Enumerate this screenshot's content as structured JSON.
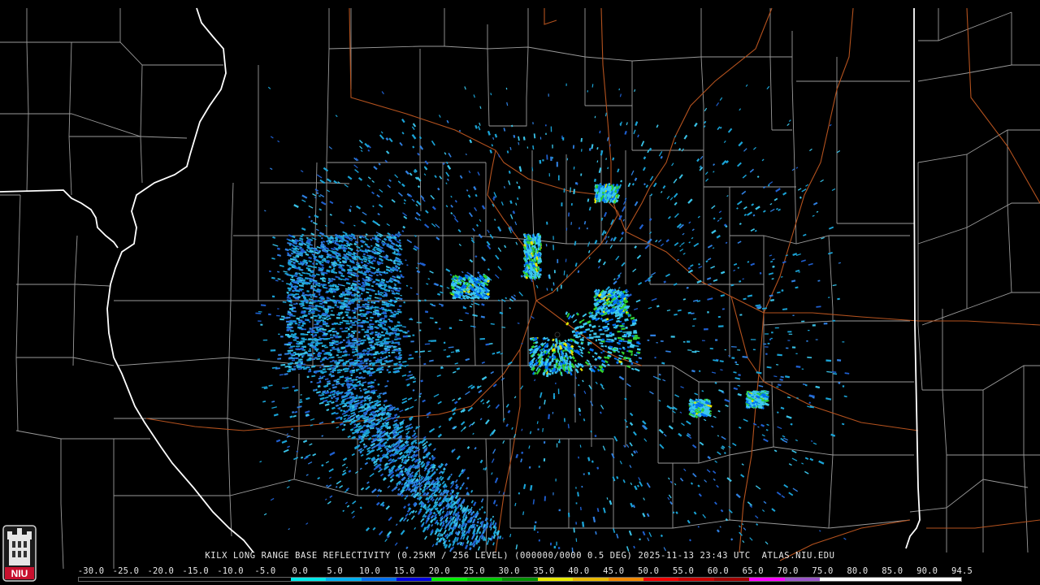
{
  "product_caption": "KILX LONG RANGE BASE REFLECTIVITY (0.25KM / 256 LEVEL) (000000/0000 0.5 DEG) 2025-11-13 23:43 UTC  ATLAS.NIU.EDU",
  "logo_text": "NIU",
  "colorbar": {
    "labels": [
      "-30.0",
      "-25.0",
      "-20.0",
      "-15.0",
      "-10.0",
      "-5.0",
      "0.0",
      "5.0",
      "10.0",
      "15.0",
      "20.0",
      "25.0",
      "30.0",
      "35.0",
      "40.0",
      "45.0",
      "50.0",
      "55.0",
      "60.0",
      "65.0",
      "70.0",
      "75.0",
      "80.0",
      "85.0",
      "90.0",
      "94.5"
    ],
    "colors": [
      "#000000",
      "#000000",
      "#000000",
      "#000000",
      "#000000",
      "#000000",
      "#00e8e8",
      "#00b0f0",
      "#0070f0",
      "#0000e0",
      "#00f000",
      "#00c800",
      "#009000",
      "#e8e800",
      "#e8b800",
      "#f08800",
      "#f00000",
      "#c80000",
      "#a00000",
      "#ff00ff",
      "#9a55c8",
      "#ffffff",
      "#ffffff",
      "#ffffff",
      "#ffffff"
    ]
  },
  "colors": {
    "background": "#000000",
    "state_borders": "#ffffff",
    "county_borders": "#9a9a9a",
    "highways": "#b4521e",
    "echo_light": "#1aa3d6",
    "echo_mid": "#2f7fe0",
    "echo_strong": "#2fd02f"
  }
}
